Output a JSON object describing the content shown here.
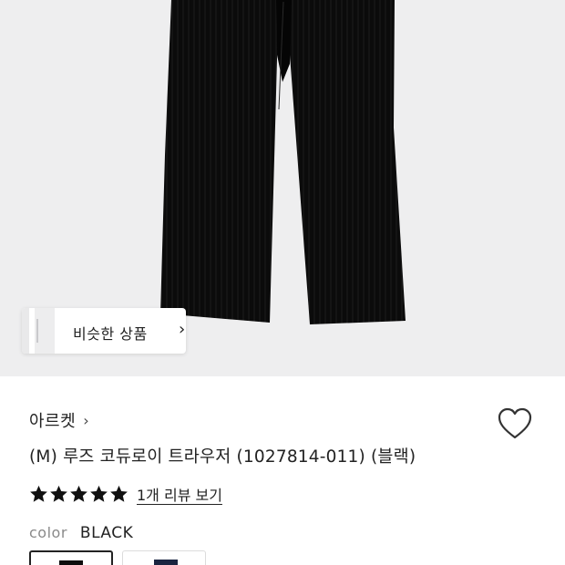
{
  "similar": {
    "label": "비슷한 상품"
  },
  "brand": {
    "name": "아르켓"
  },
  "product": {
    "title": "(M) 루즈 코듀로이 트라우저 (1027814-011) (블랙)",
    "rating": 5,
    "review_link": "1개 리뷰 보기"
  },
  "color": {
    "label": "color",
    "value": "BLACK"
  },
  "swatches": [
    {
      "color": "#0d0d0d",
      "selected": true
    },
    {
      "color": "#1a2440",
      "selected": false
    }
  ],
  "theme": {
    "star": "#111111",
    "hero_bg": "#eeeeef"
  }
}
